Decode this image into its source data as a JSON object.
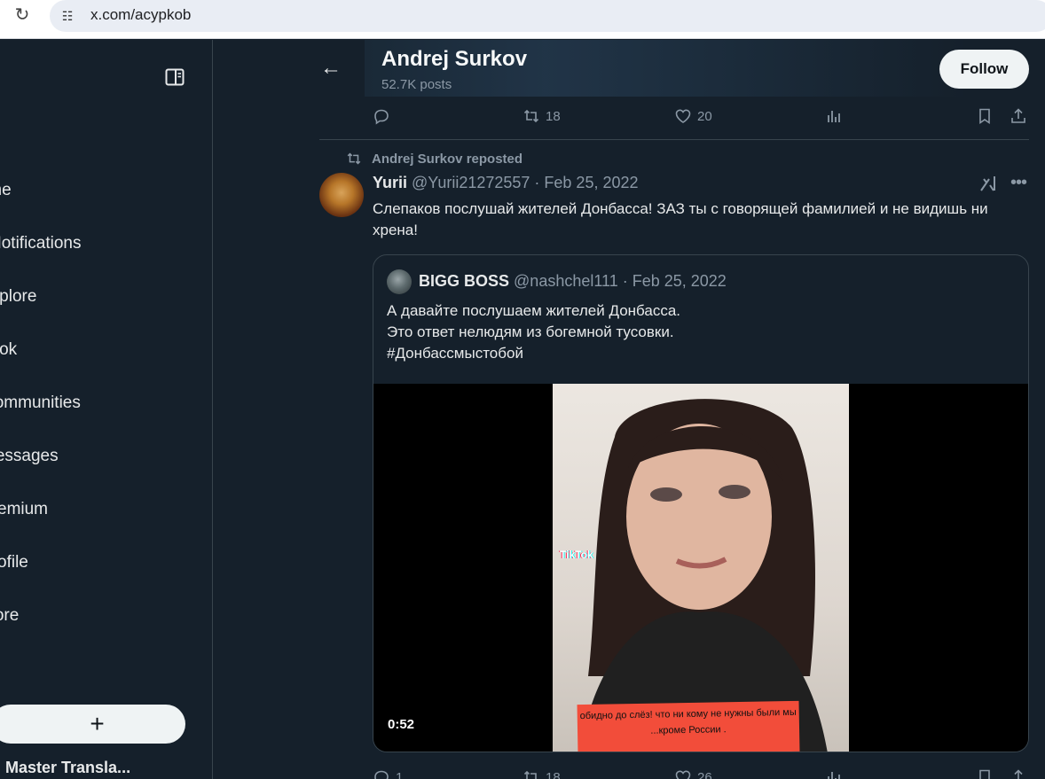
{
  "browser": {
    "url": "x.com/acypkob"
  },
  "sidebar": {
    "items": [
      {
        "label": "Home"
      },
      {
        "label": "Notifications"
      },
      {
        "label": "Explore"
      },
      {
        "label": "Grok"
      },
      {
        "label": "Communities"
      },
      {
        "label": "Messages"
      },
      {
        "label": "Premium"
      },
      {
        "label": "Profile"
      },
      {
        "label": "More"
      }
    ],
    "post_button_label": "+",
    "account_name": "Master Transla..."
  },
  "header": {
    "profile_name": "Andrej Surkov",
    "post_count": "52.7K posts",
    "follow_label": "Follow"
  },
  "previous_post_actions": {
    "replies": "",
    "reposts": "18",
    "likes": "20"
  },
  "tweet": {
    "repost_label": "Andrej Surkov reposted",
    "author_name": "Yurii",
    "author_handle": "@Yurii21272557",
    "date": "· Feb 25, 2022",
    "text": "Слепаков послушай жителей Донбасса! ЗАЗ ты с говорящей фамилией и не видишь ни хрена!",
    "quote": {
      "author_name": "BIGG BOSS",
      "author_handle": "@nashchel111",
      "date": "· Feb 25, 2022",
      "lines": [
        "А давайте послушаем жителей Донбасса.",
        "Это ответ нелюдям из богемной тусовки.",
        "#Донбассмыстобой"
      ],
      "video": {
        "duration": "0:52",
        "watermark": "TikTok",
        "caption": "обидно до слёз! что ни кому не нужны были мы ...кроме России ."
      }
    },
    "actions": {
      "replies": "1",
      "reposts": "18",
      "likes": "26"
    }
  },
  "colors": {
    "background": "#15202b",
    "border": "#38444d",
    "muted": "#8b98a5",
    "text": "#e7e9ea"
  }
}
